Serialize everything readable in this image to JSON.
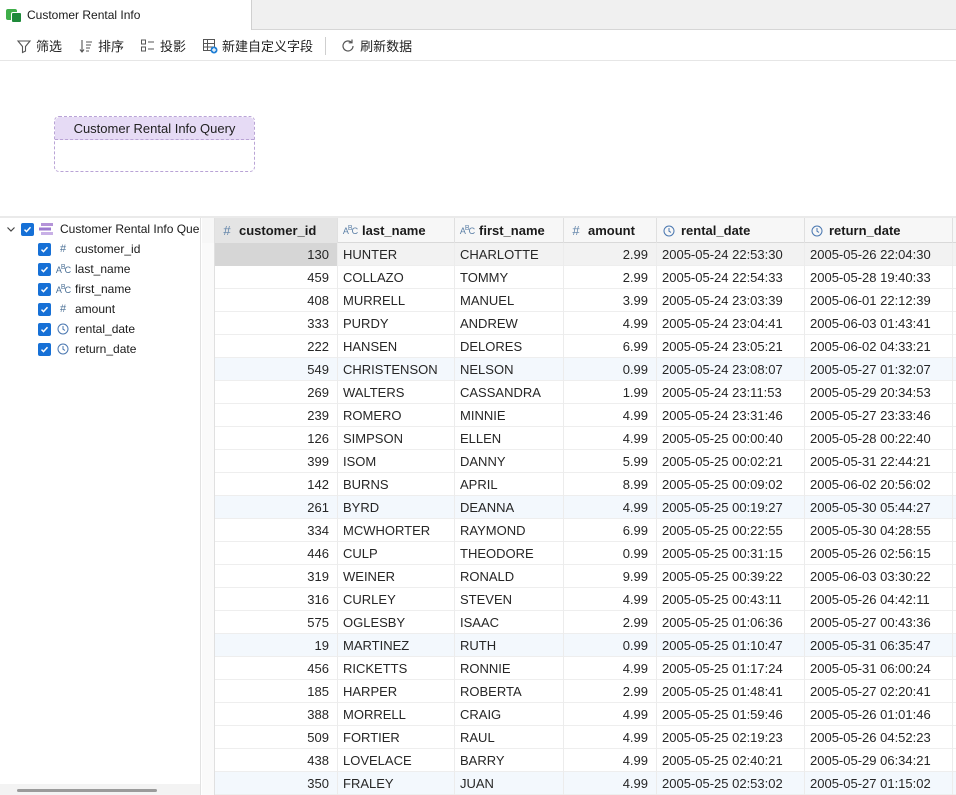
{
  "tab": {
    "title": "Customer Rental Info",
    "icon": "query-tab-icon"
  },
  "toolbar": {
    "filter_label": "筛选",
    "sort_label": "排序",
    "projection_label": "投影",
    "new_field_label": "新建自定义字段",
    "refresh_label": "刷新数据"
  },
  "canvas": {
    "node_title": "Customer Rental Info Query"
  },
  "tree": {
    "root_label": "Customer Rental Info Quer",
    "fields": [
      {
        "label": "customer_id",
        "type": "number"
      },
      {
        "label": "last_name",
        "type": "text"
      },
      {
        "label": "first_name",
        "type": "text"
      },
      {
        "label": "amount",
        "type": "number"
      },
      {
        "label": "rental_date",
        "type": "datetime"
      },
      {
        "label": "return_date",
        "type": "datetime"
      }
    ]
  },
  "grid": {
    "columns": [
      "customer_id",
      "last_name",
      "first_name",
      "amount",
      "rental_date",
      "return_date"
    ],
    "rows": [
      [
        "130",
        "HUNTER",
        "CHARLOTTE",
        "2.99",
        "2005-05-24 22:53:30",
        "2005-05-26 22:04:30"
      ],
      [
        "459",
        "COLLAZO",
        "TOMMY",
        "2.99",
        "2005-05-24 22:54:33",
        "2005-05-28 19:40:33"
      ],
      [
        "408",
        "MURRELL",
        "MANUEL",
        "3.99",
        "2005-05-24 23:03:39",
        "2005-06-01 22:12:39"
      ],
      [
        "333",
        "PURDY",
        "ANDREW",
        "4.99",
        "2005-05-24 23:04:41",
        "2005-06-03 01:43:41"
      ],
      [
        "222",
        "HANSEN",
        "DELORES",
        "6.99",
        "2005-05-24 23:05:21",
        "2005-06-02 04:33:21"
      ],
      [
        "549",
        "CHRISTENSON",
        "NELSON",
        "0.99",
        "2005-05-24 23:08:07",
        "2005-05-27 01:32:07"
      ],
      [
        "269",
        "WALTERS",
        "CASSANDRA",
        "1.99",
        "2005-05-24 23:11:53",
        "2005-05-29 20:34:53"
      ],
      [
        "239",
        "ROMERO",
        "MINNIE",
        "4.99",
        "2005-05-24 23:31:46",
        "2005-05-27 23:33:46"
      ],
      [
        "126",
        "SIMPSON",
        "ELLEN",
        "4.99",
        "2005-05-25 00:00:40",
        "2005-05-28 00:22:40"
      ],
      [
        "399",
        "ISOM",
        "DANNY",
        "5.99",
        "2005-05-25 00:02:21",
        "2005-05-31 22:44:21"
      ],
      [
        "142",
        "BURNS",
        "APRIL",
        "8.99",
        "2005-05-25 00:09:02",
        "2005-06-02 20:56:02"
      ],
      [
        "261",
        "BYRD",
        "DEANNA",
        "4.99",
        "2005-05-25 00:19:27",
        "2005-05-30 05:44:27"
      ],
      [
        "334",
        "MCWHORTER",
        "RAYMOND",
        "6.99",
        "2005-05-25 00:22:55",
        "2005-05-30 04:28:55"
      ],
      [
        "446",
        "CULP",
        "THEODORE",
        "0.99",
        "2005-05-25 00:31:15",
        "2005-05-26 02:56:15"
      ],
      [
        "319",
        "WEINER",
        "RONALD",
        "9.99",
        "2005-05-25 00:39:22",
        "2005-06-03 03:30:22"
      ],
      [
        "316",
        "CURLEY",
        "STEVEN",
        "4.99",
        "2005-05-25 00:43:11",
        "2005-05-26 04:42:11"
      ],
      [
        "575",
        "OGLESBY",
        "ISAAC",
        "2.99",
        "2005-05-25 01:06:36",
        "2005-05-27 00:43:36"
      ],
      [
        "19",
        "MARTINEZ",
        "RUTH",
        "0.99",
        "2005-05-25 01:10:47",
        "2005-05-31 06:35:47"
      ],
      [
        "456",
        "RICKETTS",
        "RONNIE",
        "4.99",
        "2005-05-25 01:17:24",
        "2005-05-31 06:00:24"
      ],
      [
        "185",
        "HARPER",
        "ROBERTA",
        "2.99",
        "2005-05-25 01:48:41",
        "2005-05-27 02:20:41"
      ],
      [
        "388",
        "MORRELL",
        "CRAIG",
        "4.99",
        "2005-05-25 01:59:46",
        "2005-05-26 01:01:46"
      ],
      [
        "509",
        "FORTIER",
        "RAUL",
        "4.99",
        "2005-05-25 02:19:23",
        "2005-05-26 04:52:23"
      ],
      [
        "438",
        "LOVELACE",
        "BARRY",
        "4.99",
        "2005-05-25 02:40:21",
        "2005-05-29 06:34:21"
      ],
      [
        "350",
        "FRALEY",
        "JUAN",
        "4.99",
        "2005-05-25 02:53:02",
        "2005-05-27 01:15:02"
      ]
    ]
  }
}
